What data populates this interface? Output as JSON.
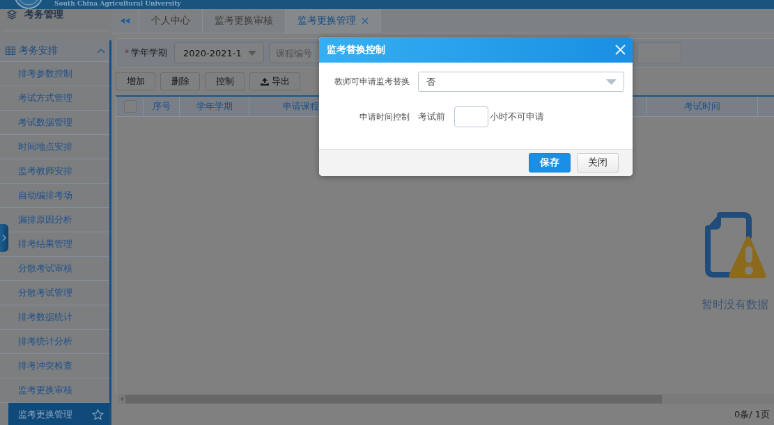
{
  "header": {
    "subtitle": "South China Agricultural University"
  },
  "sidebar": {
    "title": "考务管理",
    "section": {
      "label": "考务安排",
      "expanded": true,
      "items": [
        {
          "label": "排考参数控制",
          "selected": false
        },
        {
          "label": "考试方式管理",
          "selected": false
        },
        {
          "label": "考试数据管理",
          "selected": false
        },
        {
          "label": "时间地点安排",
          "selected": false
        },
        {
          "label": "监考教师安排",
          "selected": false
        },
        {
          "label": "自动编排考场",
          "selected": false
        },
        {
          "label": "漏排原因分析",
          "selected": false
        },
        {
          "label": "排考结果管理",
          "selected": false
        },
        {
          "label": "分散考试审核",
          "selected": false
        },
        {
          "label": "分散考试管理",
          "selected": false
        },
        {
          "label": "排考数据统计",
          "selected": false
        },
        {
          "label": "排考统计分析",
          "selected": false
        },
        {
          "label": "排考冲突检查",
          "selected": false
        },
        {
          "label": "监考更换审核",
          "selected": false
        },
        {
          "label": "监考更换管理",
          "selected": true
        }
      ]
    }
  },
  "tabs": [
    {
      "label": "个人中心",
      "selected": false,
      "closable": false
    },
    {
      "label": "监考更换审核",
      "selected": false,
      "closable": false
    },
    {
      "label": "监考更换管理",
      "selected": true,
      "closable": true
    }
  ],
  "filters": [
    {
      "kind": "select",
      "required_mark": "*",
      "label": "学年学期",
      "value": "2020-2021-1"
    },
    {
      "kind": "input",
      "placeholder": "课程编号"
    },
    {
      "kind": "input"
    }
  ],
  "toolbar": [
    {
      "kind": "plain",
      "label": "增加"
    },
    {
      "kind": "plain",
      "label": "删除"
    },
    {
      "kind": "plain",
      "label": "控制"
    },
    {
      "kind": "export",
      "label": "导出"
    }
  ],
  "table": {
    "columns": [
      {
        "kind": "checkbox",
        "checked": false
      },
      {
        "kind": "text",
        "label": "序号"
      },
      {
        "kind": "text",
        "label": "学年学期"
      },
      {
        "kind": "text",
        "label": "申请课程"
      },
      {
        "kind": "blank"
      },
      {
        "kind": "text",
        "label": "考试时间"
      },
      {
        "kind": "blank"
      }
    ],
    "empty_message": "暂时没有数据"
  },
  "pager": {
    "summary": "0条/ 1页"
  },
  "dialog": {
    "title": "监考替换控制",
    "fields": [
      {
        "kind": "select",
        "label": "教师可申请监考替换",
        "value": "否"
      },
      {
        "kind": "hours",
        "label": "申请时间控制",
        "prefix": "考试前",
        "suffix": "小时不可申请"
      }
    ],
    "buttons": [
      {
        "kind": "primary",
        "label": "保存"
      },
      {
        "kind": "secondary",
        "label": "关闭"
      }
    ]
  }
}
